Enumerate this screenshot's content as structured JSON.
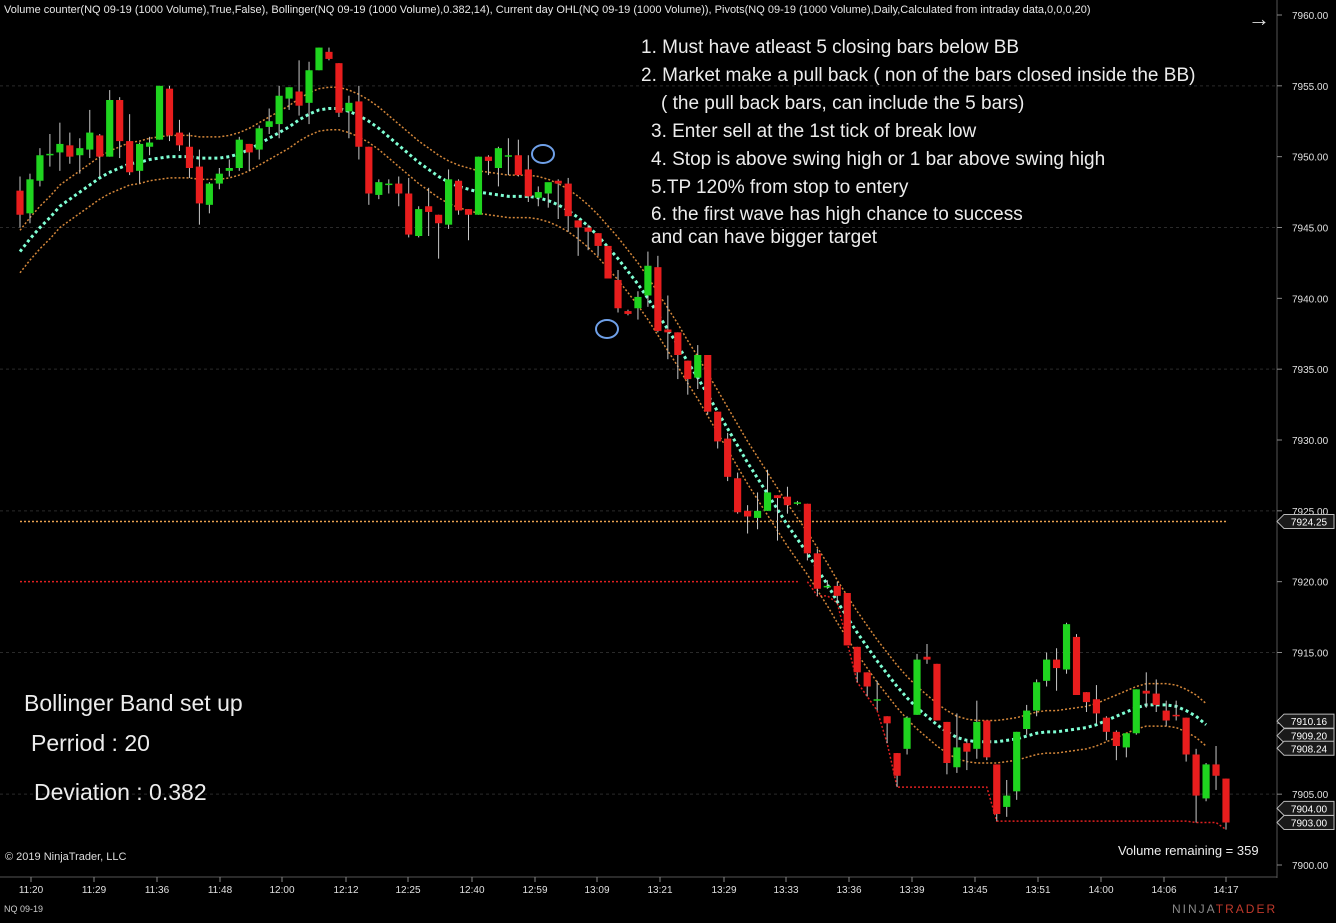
{
  "header": {
    "indicators": "Volume counter(NQ 09-19 (1000 Volume),True,False), Bollinger(NQ 09-19 (1000 Volume),0.382,14), Current day OHL(NQ 09-19 (1000 Volume)), Pivots(NQ 09-19 (1000 Volume),Daily,Calculated from intraday data,0,0,0,20)"
  },
  "notes": [
    "1. Must have atleast 5 closing bars below BB",
    "2. Market make a pull back     ( non of the bars closed inside the BB)",
    "( the pull back bars, can include the 5 bars)",
    "3. Enter sell at the 1st tick of break low",
    "4. Stop is above swing high or 1 bar above swing high",
    "5.TP 120% from stop to entery",
    "6. the first wave has high chance to success",
    "and can have bigger target"
  ],
  "setup": {
    "title": "Bollinger Band set up",
    "period": "Perriod : 20",
    "deviation": "Deviation : 0.382"
  },
  "footer": {
    "copyright": "© 2019 NinjaTrader, LLC",
    "volume_remaining": "Volume remaining = 359",
    "instrument": "NQ 09-19",
    "brand_left": "NINJA",
    "brand_right": "TRADER"
  },
  "colors": {
    "background": "#000000",
    "bull": "#1fd41f",
    "bear": "#e81d1d",
    "wick": "#c8c8c8",
    "bb_mid": "#7fffd4",
    "bb_band": "#d4873a",
    "pivot": "#e8a050",
    "day_low": "#e02020",
    "grid": "#2a2a2a",
    "axis_text": "#e0e0e0"
  },
  "chart_data": {
    "type": "candlestick",
    "ylim": [
      7900,
      7960
    ],
    "y_ticks": [
      "7960.00",
      "7955.00",
      "7950.00",
      "7945.00",
      "7940.00",
      "7935.00",
      "7930.00",
      "7925.00",
      "7920.00",
      "7915.00",
      "7910.00",
      "7905.00",
      "7900.00"
    ],
    "x_ticks": [
      "11:20",
      "11:29",
      "11:36",
      "11:48",
      "12:00",
      "12:12",
      "12:25",
      "12:40",
      "12:59",
      "13:09",
      "13:21",
      "13:29",
      "13:33",
      "13:36",
      "13:39",
      "13:45",
      "13:51",
      "14:00",
      "14:06",
      "14:17"
    ],
    "price_labels": [
      7924.25,
      7910.16,
      7909.2,
      7908.24,
      7904.0,
      7903.0
    ],
    "price_label_text": [
      "7924.25",
      "7910.16",
      "7909.20",
      "7908.24",
      "7904.00",
      "7903.00"
    ],
    "pivot_level": 7924.25,
    "day_low_level": 7920.0,
    "candles": [
      [
        7947.6,
        7948.6,
        7945.0,
        7945.9
      ],
      [
        7946.0,
        7948.8,
        7945.3,
        7948.4
      ],
      [
        7948.3,
        7950.6,
        7947.9,
        7950.1
      ],
      [
        7950.1,
        7951.6,
        7949.3,
        7950.2
      ],
      [
        7950.3,
        7952.4,
        7949.0,
        7950.9
      ],
      [
        7950.8,
        7951.7,
        7949.5,
        7950.0
      ],
      [
        7950.1,
        7951.3,
        7948.8,
        7950.6
      ],
      [
        7950.5,
        7953.3,
        7949.9,
        7951.7
      ],
      [
        7951.5,
        7951.6,
        7948.6,
        7950.0
      ],
      [
        7950.0,
        7954.7,
        7950.0,
        7954.0
      ],
      [
        7954.0,
        7954.2,
        7949.9,
        7951.1
      ],
      [
        7951.1,
        7953.0,
        7948.7,
        7948.9
      ],
      [
        7949.0,
        7951.0,
        7948.1,
        7950.9
      ],
      [
        7950.7,
        7951.4,
        7950.1,
        7951.0
      ],
      [
        7951.2,
        7955.0,
        7951.2,
        7955.0
      ],
      [
        7954.8,
        7955.0,
        7951.1,
        7951.5
      ],
      [
        7951.7,
        7952.6,
        7950.4,
        7950.8
      ],
      [
        7950.7,
        7951.7,
        7948.5,
        7949.2
      ],
      [
        7949.3,
        7950.5,
        7945.2,
        7946.7
      ],
      [
        7946.6,
        7948.2,
        7946.0,
        7948.1
      ],
      [
        7948.1,
        7949.2,
        7947.7,
        7948.8
      ],
      [
        7949.0,
        7949.8,
        7948.6,
        7949.2
      ],
      [
        7949.2,
        7951.4,
        7949.0,
        7951.2
      ],
      [
        7950.9,
        7950.9,
        7949.0,
        7950.3
      ],
      [
        7950.5,
        7952.2,
        7949.8,
        7952.0
      ],
      [
        7952.1,
        7953.4,
        7951.6,
        7952.5
      ],
      [
        7952.3,
        7955.0,
        7951.3,
        7954.3
      ],
      [
        7954.1,
        7954.9,
        7953.3,
        7954.9
      ],
      [
        7954.6,
        7956.8,
        7952.9,
        7953.6
      ],
      [
        7953.8,
        7956.7,
        7952.3,
        7956.1
      ],
      [
        7956.1,
        7957.7,
        7956.1,
        7957.7
      ],
      [
        7957.4,
        7957.7,
        7956.8,
        7956.9
      ],
      [
        7956.6,
        7956.6,
        7952.8,
        7953.1
      ],
      [
        7953.2,
        7954.3,
        7951.3,
        7953.8
      ],
      [
        7953.9,
        7955.0,
        7949.8,
        7950.7
      ],
      [
        7950.7,
        7950.7,
        7946.6,
        7947.4
      ],
      [
        7947.3,
        7948.4,
        7947.0,
        7948.2
      ],
      [
        7948.0,
        7948.4,
        7947.4,
        7948.1
      ],
      [
        7948.1,
        7948.6,
        7946.5,
        7947.4
      ],
      [
        7947.4,
        7948.5,
        7944.3,
        7944.5
      ],
      [
        7944.4,
        7946.5,
        7944.3,
        7946.3
      ],
      [
        7946.5,
        7947.8,
        7944.4,
        7946.1
      ],
      [
        7945.9,
        7945.9,
        7942.8,
        7945.3
      ],
      [
        7945.2,
        7949.1,
        7944.9,
        7948.4
      ],
      [
        7948.3,
        7948.4,
        7945.9,
        7946.2
      ],
      [
        7946.3,
        7946.3,
        7944.1,
        7945.9
      ],
      [
        7945.9,
        7950.0,
        7945.9,
        7950.0
      ],
      [
        7950.0,
        7950.1,
        7948.7,
        7949.7
      ],
      [
        7949.2,
        7950.7,
        7947.9,
        7950.6
      ],
      [
        7950.1,
        7951.3,
        7948.7,
        7950.1
      ],
      [
        7950.1,
        7951.2,
        7948.6,
        7948.7
      ],
      [
        7949.1,
        7950.1,
        7946.8,
        7947.2
      ],
      [
        7947.1,
        7947.9,
        7946.5,
        7947.5
      ],
      [
        7947.4,
        7947.6,
        7946.4,
        7948.2
      ],
      [
        7948.3,
        7948.4,
        7945.6,
        7948.1
      ],
      [
        7948.1,
        7948.5,
        7944.7,
        7945.8
      ],
      [
        7945.5,
        7945.5,
        7943.0,
        7945.0
      ],
      [
        7945.0,
        7945.2,
        7943.4,
        7944.7
      ],
      [
        7944.6,
        7944.6,
        7943.0,
        7943.7
      ],
      [
        7943.7,
        7943.7,
        7941.5,
        7941.4
      ],
      [
        7941.3,
        7942.0,
        7939.0,
        7939.3
      ],
      [
        7939.1,
        7939.2,
        7938.8,
        7938.9
      ],
      [
        7939.3,
        7940.5,
        7938.5,
        7940.1
      ],
      [
        7940.2,
        7943.3,
        7939.4,
        7942.3
      ],
      [
        7942.2,
        7943.0,
        7937.6,
        7937.7
      ],
      [
        7937.8,
        7940.2,
        7935.7,
        7937.6
      ],
      [
        7937.6,
        7937.6,
        7934.3,
        7936.0
      ],
      [
        7935.6,
        7935.6,
        7933.2,
        7934.3
      ],
      [
        7934.4,
        7936.7,
        7933.6,
        7936.0
      ],
      [
        7936.0,
        7936.0,
        7931.8,
        7932.0
      ],
      [
        7932.0,
        7932.0,
        7929.4,
        7929.9
      ],
      [
        7930.1,
        7930.5,
        7927.1,
        7927.4
      ],
      [
        7927.3,
        7927.7,
        7924.8,
        7924.9
      ],
      [
        7925.0,
        7925.4,
        7923.4,
        7924.6
      ],
      [
        7924.5,
        7926.3,
        7923.7,
        7925.0
      ],
      [
        7925.0,
        7927.9,
        7925.0,
        7926.3
      ],
      [
        7926.1,
        7926.1,
        7922.9,
        7925.9
      ],
      [
        7926.0,
        7926.7,
        7924.8,
        7925.4
      ],
      [
        7925.6,
        7925.7,
        7925.4,
        7925.6
      ],
      [
        7925.5,
        7925.5,
        7921.5,
        7922.0
      ],
      [
        7922.0,
        7922.3,
        7919.0,
        7919.5
      ],
      [
        7919.6,
        7920.1,
        7919.5,
        7919.7
      ],
      [
        7919.7,
        7920.0,
        7918.5,
        7919.0
      ],
      [
        7919.2,
        7919.2,
        7915.7,
        7915.5
      ],
      [
        7915.4,
        7915.4,
        7912.9,
        7913.6
      ],
      [
        7913.6,
        7913.6,
        7911.9,
        7912.6
      ],
      [
        7911.7,
        7913.0,
        7910.9,
        7911.7
      ],
      [
        7910.5,
        7910.5,
        7908.6,
        7910.0
      ],
      [
        7907.9,
        7907.9,
        7905.5,
        7906.3
      ],
      [
        7908.2,
        7910.5,
        7907.8,
        7910.4
      ],
      [
        7910.6,
        7914.9,
        7910.6,
        7914.5
      ],
      [
        7914.7,
        7915.6,
        7914.2,
        7914.5
      ],
      [
        7914.2,
        7914.2,
        7910.4,
        7910.2
      ],
      [
        7910.1,
        7910.1,
        7906.4,
        7907.2
      ],
      [
        7906.9,
        7910.7,
        7906.5,
        7908.3
      ],
      [
        7908.6,
        7908.8,
        7906.7,
        7908.0
      ],
      [
        7908.2,
        7911.6,
        7907.5,
        7910.1
      ],
      [
        7910.2,
        7910.2,
        7907.4,
        7907.6
      ],
      [
        7907.1,
        7907.1,
        7903.1,
        7903.6
      ],
      [
        7904.1,
        7906.0,
        7903.4,
        7904.9
      ],
      [
        7905.2,
        7909.4,
        7904.6,
        7909.4
      ],
      [
        7909.6,
        7911.3,
        7909.2,
        7910.9
      ],
      [
        7910.9,
        7913.1,
        7910.5,
        7912.9
      ],
      [
        7913.0,
        7915.0,
        7912.6,
        7914.5
      ],
      [
        7914.5,
        7915.3,
        7912.3,
        7913.9
      ],
      [
        7913.8,
        7917.1,
        7913.5,
        7917.0
      ],
      [
        7916.1,
        7916.3,
        7912.0,
        7912.0
      ],
      [
        7912.2,
        7912.2,
        7910.8,
        7911.5
      ],
      [
        7911.7,
        7912.7,
        7910.0,
        7910.7
      ],
      [
        7910.4,
        7910.5,
        7908.8,
        7909.4
      ],
      [
        7909.4,
        7909.5,
        7907.4,
        7908.4
      ],
      [
        7908.3,
        7909.0,
        7907.6,
        7909.3
      ],
      [
        7909.3,
        7912.4,
        7909.2,
        7912.4
      ],
      [
        7912.3,
        7913.6,
        7911.1,
        7912.1
      ],
      [
        7912.1,
        7913.1,
        7910.8,
        7911.3
      ],
      [
        7910.9,
        7911.6,
        7909.8,
        7910.2
      ],
      [
        7910.6,
        7911.6,
        7910.2,
        7910.5
      ],
      [
        7910.4,
        7910.4,
        7907.3,
        7907.8
      ],
      [
        7907.8,
        7908.2,
        7903.0,
        7904.9
      ],
      [
        7904.7,
        7907.2,
        7904.5,
        7907.1
      ],
      [
        7907.1,
        7908.4,
        7905.3,
        7906.3
      ],
      [
        7906.1,
        7906.1,
        7902.5,
        7903.0
      ]
    ],
    "bb_middle": [
      7943.3,
      7944.2,
      7945.0,
      7945.7,
      7946.5,
      7947.0,
      7947.5,
      7948.0,
      7948.5,
      7948.9,
      7949.2,
      7949.5,
      7949.6,
      7949.8,
      7949.9,
      7950.0,
      7950.0,
      7950.0,
      7949.9,
      7949.9,
      7949.9,
      7950.0,
      7950.2,
      7950.5,
      7950.9,
      7951.3,
      7951.7,
      7952.1,
      7952.6,
      7953.0,
      7953.3,
      7953.4,
      7953.4,
      7953.2,
      7952.9,
      7952.5,
      7952.0,
      7951.4,
      7950.8,
      7950.2,
      7949.6,
      7949.1,
      7948.6,
      7948.2,
      7947.9,
      7947.7,
      7947.5,
      7947.4,
      7947.3,
      7947.2,
      7947.2,
      7947.2,
      7947.1,
      7946.9,
      7946.6,
      7946.2,
      7945.7,
      7945.1,
      7944.4,
      7943.6,
      7942.8,
      7941.9,
      7941.0,
      7940.0,
      7938.9,
      7937.8,
      7936.7,
      7935.5,
      7934.4,
      7933.2,
      7932.0,
      7930.8,
      7929.6,
      7928.4,
      7927.3,
      7926.2,
      7925.1,
      7924.0,
      7923.0,
      7922.0,
      7920.9,
      7919.8,
      7918.6,
      7917.5,
      7916.4,
      7915.4,
      7914.4,
      7913.5,
      7912.6,
      7911.8,
      7911.1,
      7910.5,
      7909.9,
      7909.4,
      7909.0,
      7908.8,
      7908.7,
      7908.7,
      7908.7,
      7908.8,
      7908.9,
      7909.1,
      7909.3,
      7909.4,
      7909.4,
      7909.5,
      7909.6,
      7909.7,
      7909.9,
      7910.2,
      7910.5,
      7910.8,
      7911.1,
      7911.3,
      7911.3,
      7911.3,
      7911.2,
      7910.9,
      7910.5,
      7909.9
    ],
    "bb_width": 1.5
  }
}
